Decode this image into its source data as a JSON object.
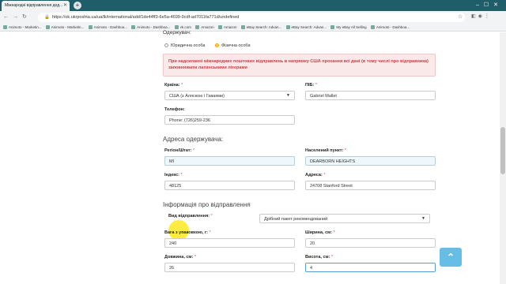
{
  "browser": {
    "tab_title": "Міжнародні відправлення дод...",
    "url": "https://ok.ukrposhta.ua/ua/lk/international/add/1de44ff3-6e5a-4699-9cdf-ad7011fa771d/undefined",
    "bookmarks": [
      "Animoto - Marketin...",
      "Animoto - Marketin...",
      "Animoto - Dashboa...",
      "Animoto - Dashboa...",
      "vk.com",
      "Amazon",
      "Amazon",
      "eBay Search: Advan...",
      "eBay Search: Advan...",
      "My eBay All Selling",
      "Animoto - Dashboa..."
    ]
  },
  "recipient": {
    "header": "Одержувач:",
    "type_options": [
      "Юридична особа",
      "Фізична особа"
    ],
    "selected_type": "Фізична особа",
    "notice": "При надсиланні міжнародних поштових відправлень в напрямку США прохання всі дані (в тому числі про відправника) заповнювати латинськими літерами",
    "country_label": "Країна:",
    "country_value": "США (з Аляскою і Гаваями)",
    "name_label": "ПІБ:",
    "name_value": "Gabriel Mallet",
    "phone_label": "Телефон:",
    "phone_value": "Phone: (726)259-236"
  },
  "address": {
    "title": "Адреса одержувача:",
    "region_label": "Регіон/Штат:",
    "region_value": "MI",
    "city_label": "Населений пункт:",
    "city_value": "DEARBORN HEIGHTS",
    "zip_label": "Індекс:",
    "zip_value": "48125",
    "street_label": "Адреса:",
    "street_value": "24708 Stanford Street"
  },
  "shipment": {
    "title": "Інформація про відправлення",
    "type_label": "Вид відправлення:",
    "type_value": "Дрібний пакет рекомендований",
    "weight_label": "Вага з упаковкою, г:",
    "weight_value": "240",
    "width_label": "Ширина, см:",
    "width_value": "20",
    "length_label": "Довжина, см:",
    "length_value": "26",
    "height_label": "Висота, см:",
    "height_value": "4"
  }
}
